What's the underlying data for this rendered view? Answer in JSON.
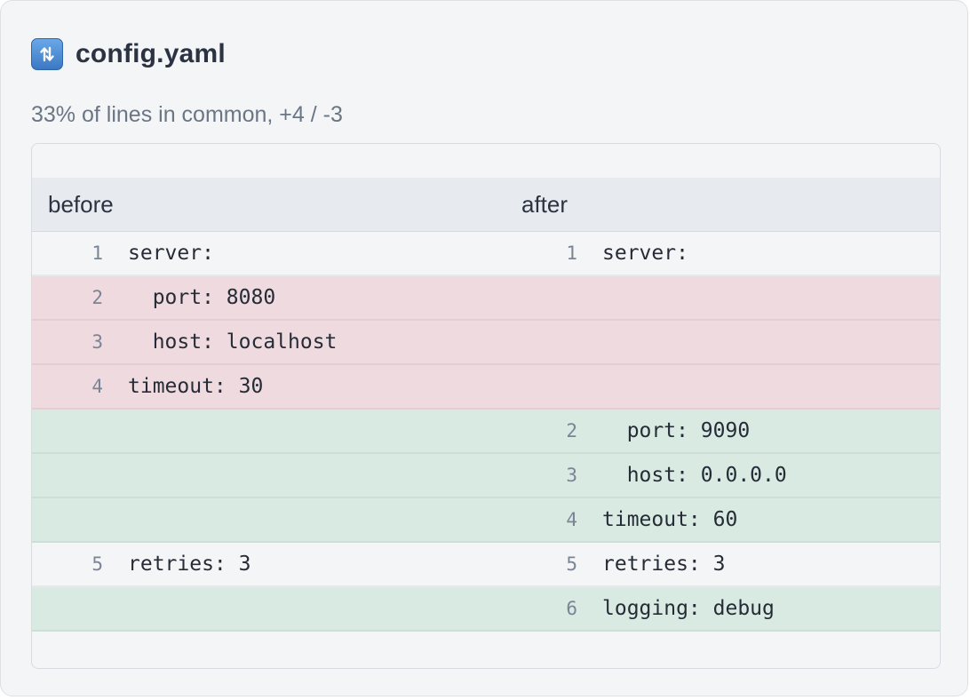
{
  "file": {
    "icon": "swap-arrows-icon",
    "name": "config.yaml"
  },
  "summary": "33% of lines in common, +4 / -3",
  "columns": {
    "before": "before",
    "after": "after"
  },
  "colors": {
    "removed_row": "#efdadf",
    "added_row": "#d9eae3",
    "icon_blue": "#3b78c4"
  },
  "rows": [
    {
      "type": "unchanged",
      "left_num": "1",
      "left_code": "server:",
      "right_num": "1",
      "right_code": "server:"
    },
    {
      "type": "removed",
      "left_num": "2",
      "left_code": "  port: 8080",
      "right_num": "",
      "right_code": ""
    },
    {
      "type": "removed",
      "left_num": "3",
      "left_code": "  host: localhost",
      "right_num": "",
      "right_code": ""
    },
    {
      "type": "removed",
      "left_num": "4",
      "left_code": "timeout: 30",
      "right_num": "",
      "right_code": ""
    },
    {
      "type": "added",
      "left_num": "",
      "left_code": "",
      "right_num": "2",
      "right_code": "  port: 9090"
    },
    {
      "type": "added",
      "left_num": "",
      "left_code": "",
      "right_num": "3",
      "right_code": "  host: 0.0.0.0"
    },
    {
      "type": "added",
      "left_num": "",
      "left_code": "",
      "right_num": "4",
      "right_code": "timeout: 60"
    },
    {
      "type": "unchanged",
      "left_num": "5",
      "left_code": "retries: 3",
      "right_num": "5",
      "right_code": "retries: 3"
    },
    {
      "type": "added",
      "left_num": "",
      "left_code": "",
      "right_num": "6",
      "right_code": "logging: debug"
    }
  ]
}
